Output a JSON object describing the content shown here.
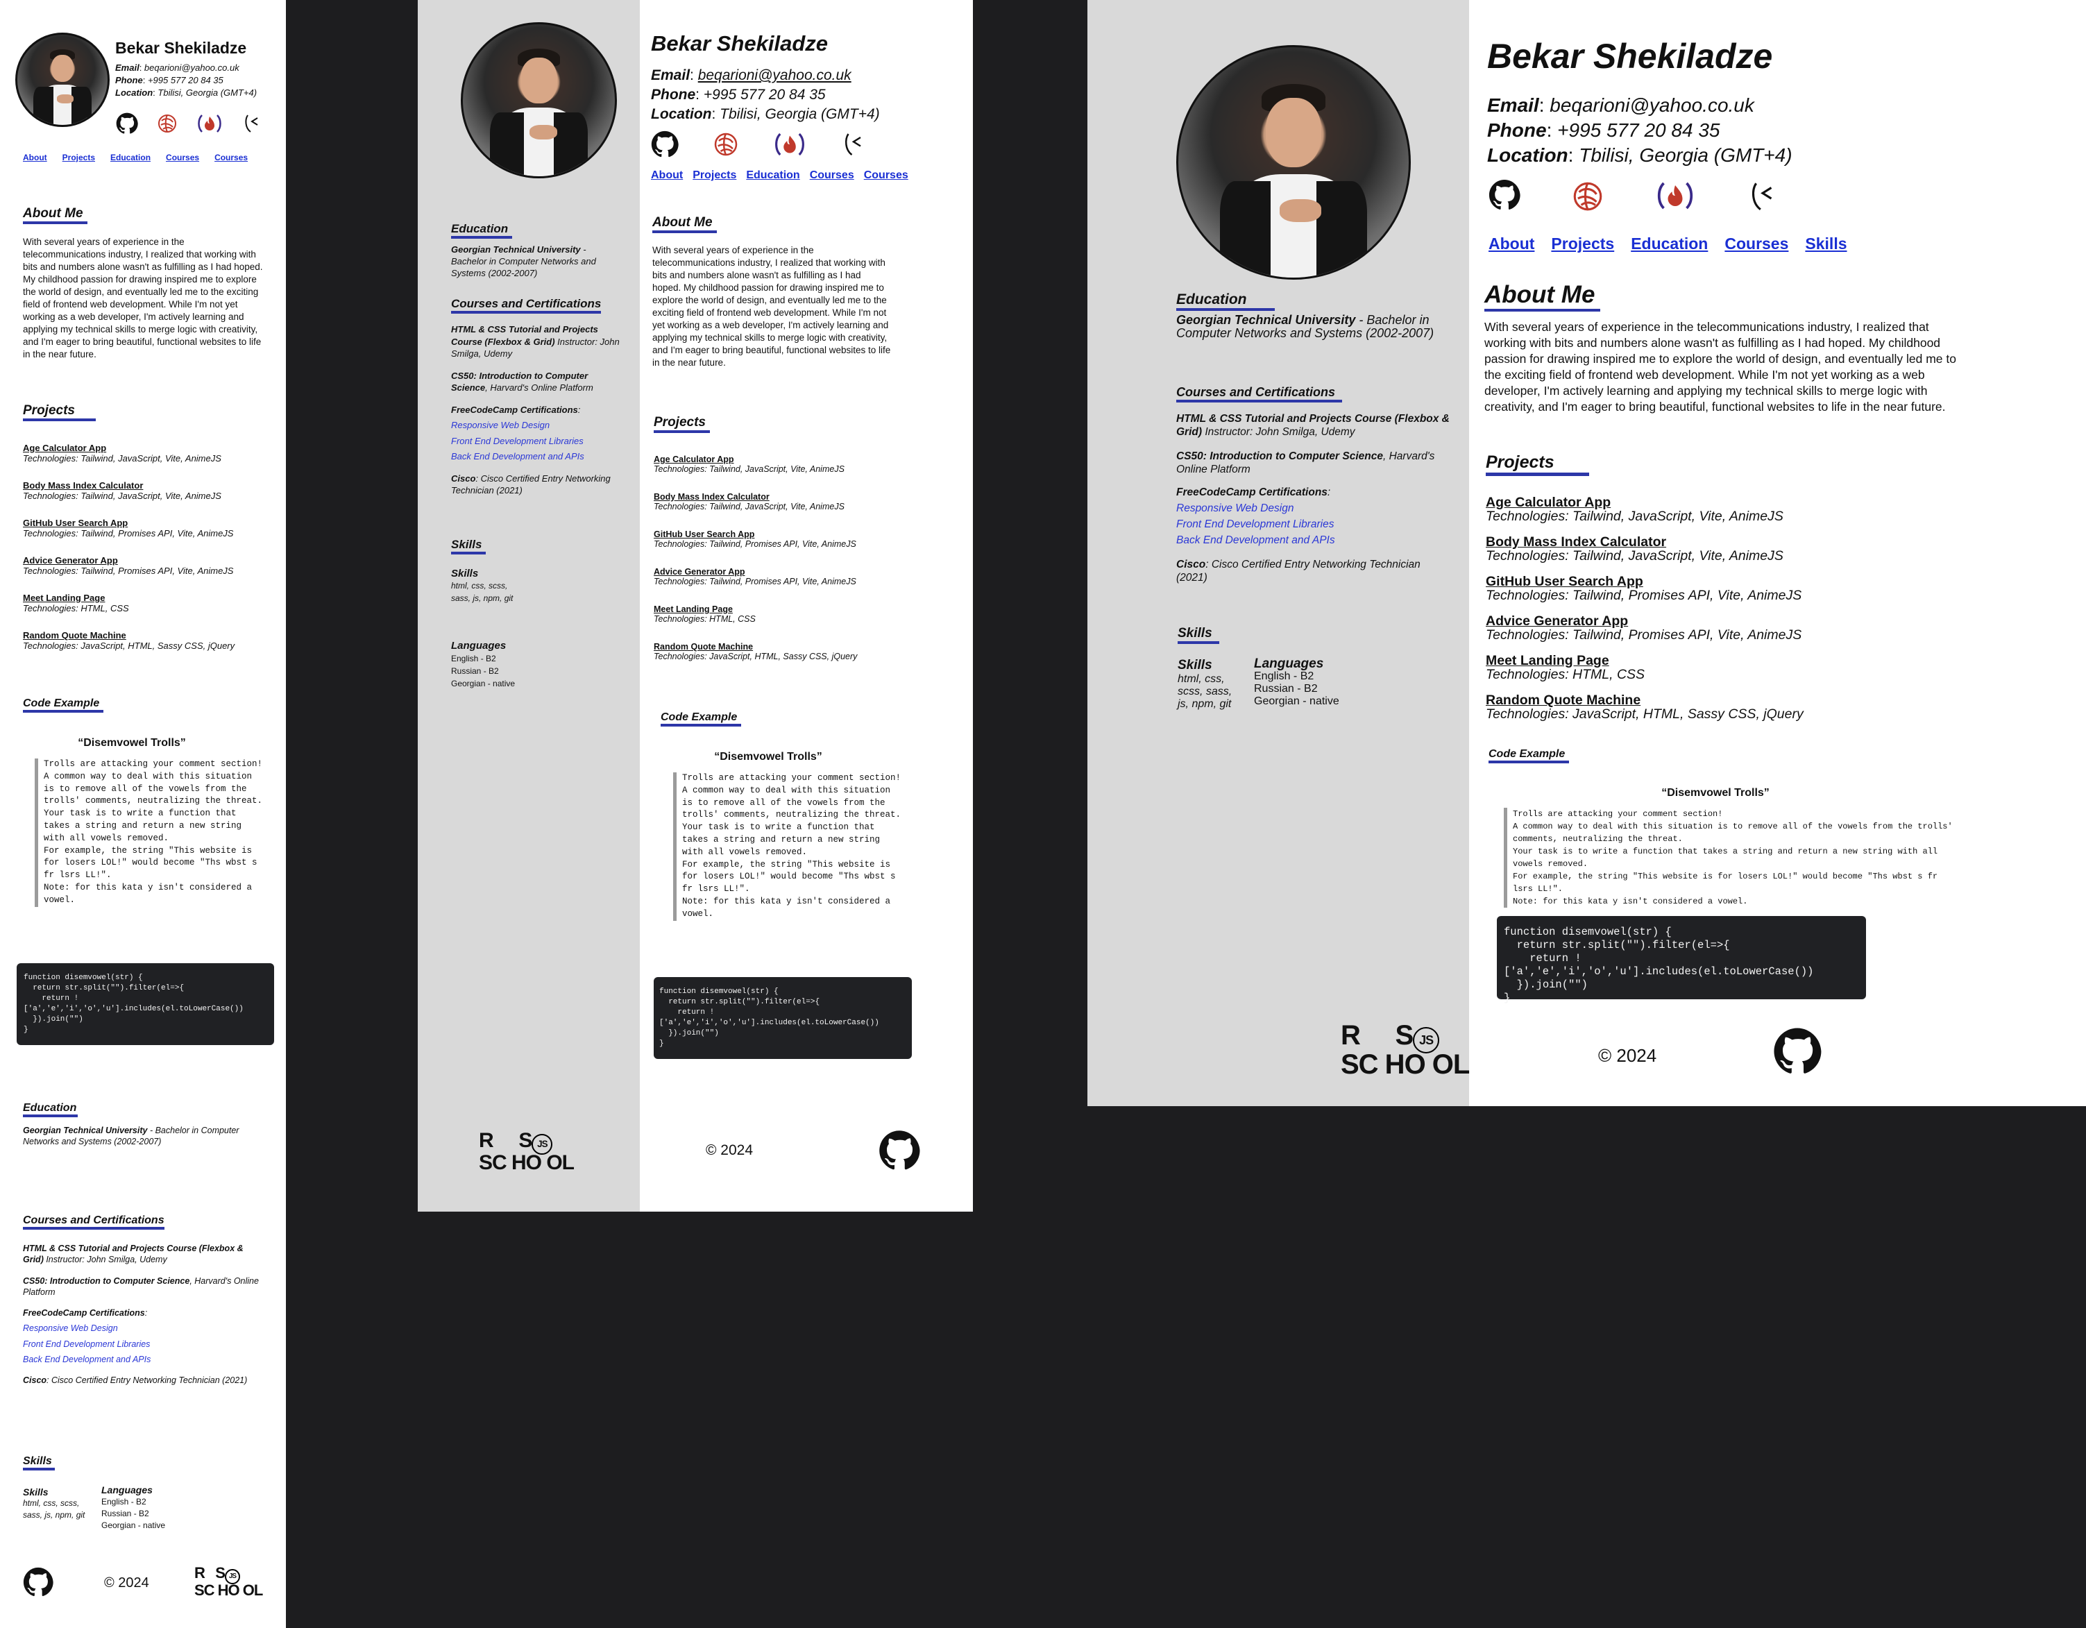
{
  "profile": {
    "name": "Bekar Shekiladze",
    "email_label": "Email",
    "email": "beqarioni@yahoo.co.uk",
    "phone_label": "Phone",
    "phone": "+995 577 20 84 35",
    "location_label": "Location",
    "location": "Tbilisi, Georgia (GMT+4)"
  },
  "icons": [
    "github-icon",
    "freecodecamp-swirl-icon",
    "freecodecamp-flame-icon",
    "codewars-icon"
  ],
  "nav": {
    "small": [
      "About",
      "Projects",
      "Education",
      "Courses",
      "Courses"
    ],
    "medium": [
      "About",
      "Projects",
      "Education",
      "Courses",
      "Courses"
    ],
    "large": [
      "About",
      "Projects",
      "Education",
      "Courses",
      "Skills"
    ]
  },
  "about": {
    "heading": "About Me",
    "text": "With several years of experience in the telecommunications industry, I realized that working with bits and numbers alone wasn't as fulfilling as I had hoped. My childhood passion for drawing inspired me to explore the world of design, and eventually led me to the exciting field of frontend web development. While I'm not yet working as a web developer, I'm actively learning and applying my technical skills to merge logic with creativity, and I'm eager to bring beautiful, functional websites to life in the near future."
  },
  "projects": {
    "heading": "Projects",
    "items": [
      {
        "title": "Age Calculator App",
        "tech": "Technologies: Tailwind, JavaScript, Vite, AnimeJS"
      },
      {
        "title": "Body Mass Index Calculator",
        "tech": "Technologies: Tailwind, JavaScript, Vite, AnimeJS"
      },
      {
        "title": "GitHub User Search App",
        "tech": "Technologies: Tailwind, Promises API, Vite, AnimeJS"
      },
      {
        "title": "Advice Generator App",
        "tech": "Technologies: Tailwind, Promises API, Vite, AnimeJS"
      },
      {
        "title": "Meet Landing Page",
        "tech": "Technologies: HTML, CSS"
      },
      {
        "title": "Random Quote Machine",
        "tech": "Technologies: JavaScript, HTML, Sassy CSS, jQuery"
      }
    ]
  },
  "code_example": {
    "heading": "Code Example",
    "kata_title": "Disemvowel Trolls",
    "description": "Trolls are attacking your comment section!\nA common way to deal with this situation is to remove all of the vowels from the trolls' comments, neutralizing the threat.\nYour task is to write a function that takes a string and return a new string with all vowels removed.\nFor example, the string \"This website is for losers LOL!\" would become \"Ths wbst s fr lsrs LL!\".\nNote: for this kata y isn't considered a vowel.",
    "code": "function disemvowel(str) {\n  return str.split(\"\").filter(el=>{\n    return !['a','e','i','o','u'].includes(el.toLowerCase())\n  }).join(\"\")\n}"
  },
  "education": {
    "heading": "Education",
    "school": "Georgian Technical University",
    "degree": " - Bachelor in Computer Networks and Systems (2002-2007)"
  },
  "courses": {
    "heading": "Courses and Certifications",
    "c1_title": "HTML & CSS Tutorial and Projects Course (Flexbox & Grid)",
    "c1_rest": " Instructor: John Smilga, Udemy",
    "c2_title": "CS50: Introduction to Computer Science",
    "c2_rest": ", Harvard's Online Platform",
    "fcc_label": "FreeCodeCamp Certifications",
    "fcc_links": [
      "Responsive Web Design",
      "Front End Development Libraries",
      "Back End Development and APIs"
    ],
    "cisco_label": "Cisco",
    "cisco_text": ": Cisco Certified Entry Networking Technician (2021)"
  },
  "skills": {
    "heading": "Skills",
    "skills_label": "Skills",
    "skills_text": "html, css, scss, sass, js, npm, git",
    "skills_text_large": "html, css, scss, sass, js, npm, git",
    "languages_label": "Languages",
    "languages": [
      "English - B2",
      "Russian - B2",
      "Georgian - native"
    ]
  },
  "footer": {
    "copyright": "© 2024",
    "rs_logo": "RS SCHOOL JS"
  },
  "colors": {
    "background": "#1d1d1f",
    "panel_white": "#ffffff",
    "sidebar_gray": "#d9d9d9",
    "link_blue": "#1a2fd3",
    "heading_underline": "#2d37a8",
    "code_bg": "#202124"
  }
}
